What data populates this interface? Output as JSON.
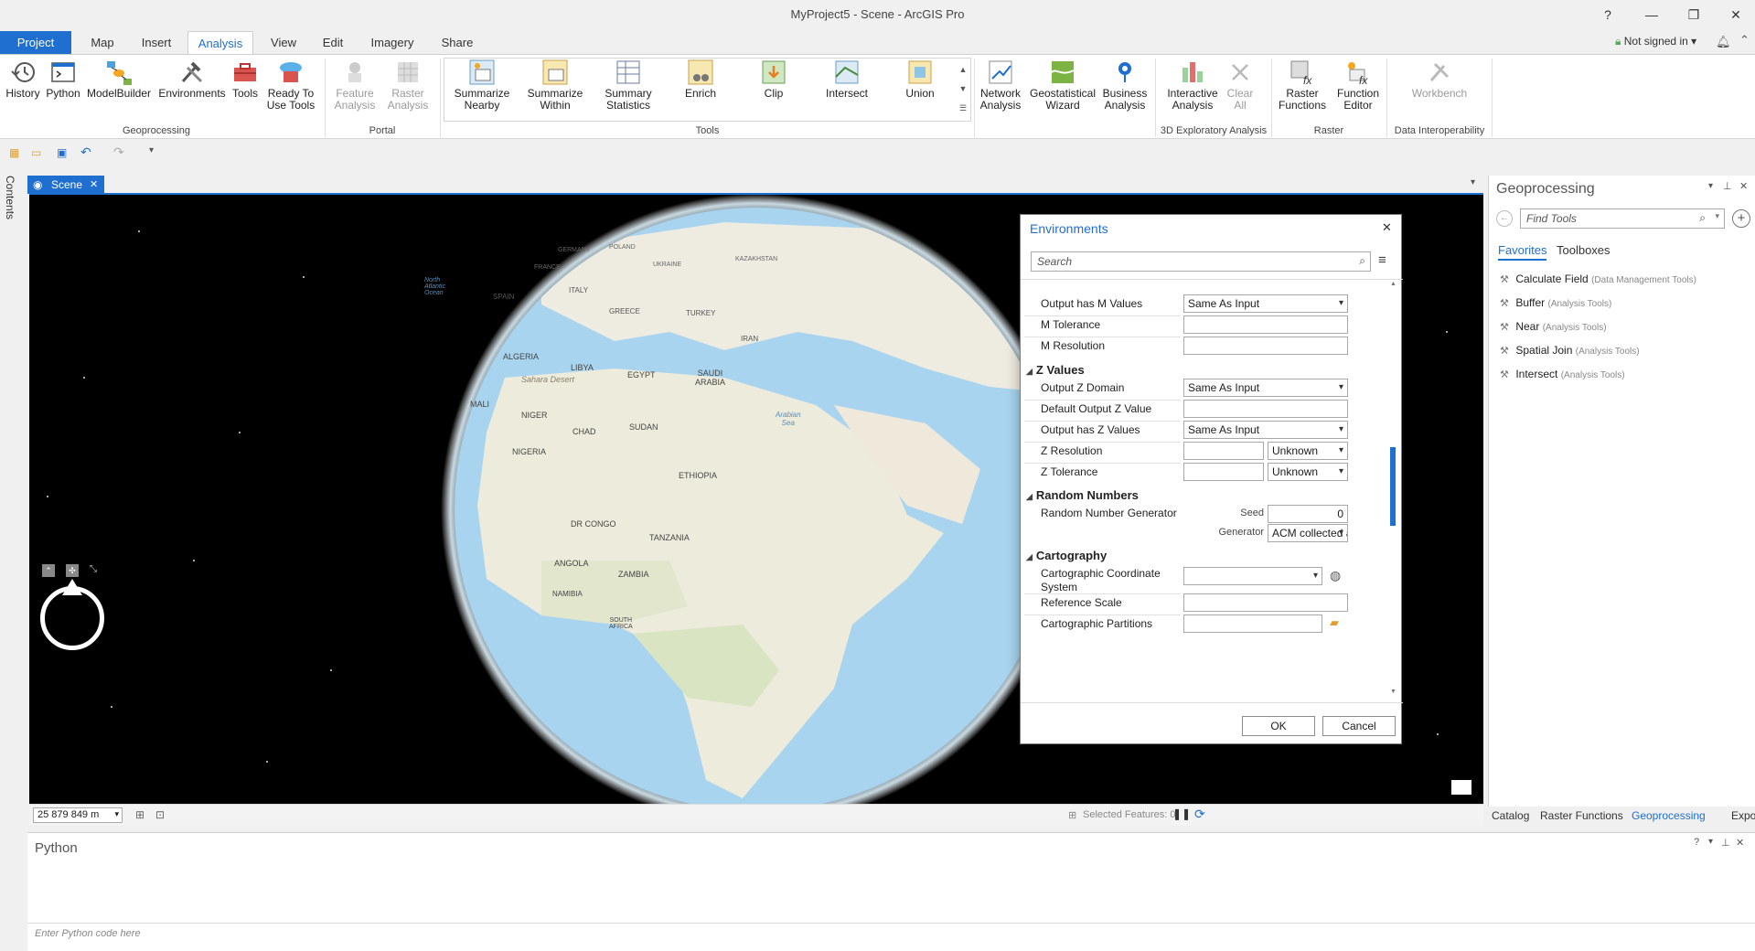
{
  "window": {
    "title": "MyProject5 - Scene - ArcGIS Pro",
    "help": "?",
    "minimize": "—",
    "restore": "❐",
    "close": "✕"
  },
  "ribbon_tabs": [
    "Project",
    "Map",
    "Insert",
    "Analysis",
    "View",
    "Edit",
    "Imagery",
    "Share"
  ],
  "account": {
    "label": "Not signed in",
    "caret": "▾"
  },
  "ribbon": {
    "geoprocessing": {
      "label": "Geoprocessing",
      "buttons": [
        {
          "label": "History"
        },
        {
          "label": "Python"
        },
        {
          "label": "ModelBuilder"
        },
        {
          "label": "Environments"
        },
        {
          "label": "Tools"
        },
        {
          "label": "Ready To\nUse Tools"
        }
      ]
    },
    "portal": {
      "label": "Portal",
      "buttons": [
        {
          "label": "Feature\nAnalysis"
        },
        {
          "label": "Raster\nAnalysis"
        }
      ]
    },
    "tools": {
      "label": "Tools",
      "buttons": [
        {
          "label": "Summarize\nNearby"
        },
        {
          "label": "Summarize\nWithin"
        },
        {
          "label": "Summary\nStatistics"
        },
        {
          "label": "Enrich"
        },
        {
          "label": "Clip"
        },
        {
          "label": "Intersect"
        },
        {
          "label": "Union"
        }
      ]
    },
    "other": {
      "buttons": [
        {
          "label": "Network\nAnalysis"
        },
        {
          "label": "Geostatistical\nWizard"
        },
        {
          "label": "Business\nAnalysis"
        }
      ]
    },
    "exploratory": {
      "label": "3D Exploratory Analysis",
      "buttons": [
        {
          "label": "Interactive\nAnalysis"
        },
        {
          "label": "Clear\nAll"
        }
      ]
    },
    "raster": {
      "label": "Raster",
      "buttons": [
        {
          "label": "Raster\nFunctions"
        },
        {
          "label": "Function\nEditor"
        }
      ]
    },
    "interop": {
      "label": "Data Interoperability",
      "buttons": [
        {
          "label": "Workbench"
        }
      ]
    }
  },
  "side_strip": {
    "contents": "Contents"
  },
  "scene_tab": {
    "label": "Scene",
    "close": "✕"
  },
  "map": {
    "labels": [
      "GERMANY",
      "POLAND",
      "UKRAINE",
      "KAZAKHSTAN",
      "FRANCE",
      "SPAIN",
      "ITALY",
      "GREECE",
      "TURKEY",
      "IRAN",
      "ALGERIA",
      "LIBYA",
      "EGYPT",
      "SAUDI\nARABIA",
      "Sahara Desert",
      "MALI",
      "NIGER",
      "CHAD",
      "SUDAN",
      "NIGERIA",
      "ETHIOPIA",
      "DR CONGO",
      "TANZANIA",
      "ANGOLA",
      "ZAMBIA",
      "NAMIBIA",
      "SOUTH\nAFRICA",
      "Arabian\nSea",
      "North\nAtlantic\nOcean"
    ]
  },
  "status": {
    "scale": "25 879 849 m",
    "selected_features": "Selected Features: 0"
  },
  "environments": {
    "title": "Environments",
    "close": "✕",
    "search_placeholder": "Search",
    "rows": [
      {
        "label": "Output has M Values",
        "value": "Same As Input"
      },
      {
        "label": "M Tolerance",
        "value": ""
      },
      {
        "label": "M Resolution",
        "value": ""
      }
    ],
    "z_values": {
      "section": "Z Values",
      "rows": [
        {
          "label": "Output Z Domain",
          "value": "Same As Input"
        },
        {
          "label": "Default Output Z Value",
          "value": ""
        },
        {
          "label": "Output has Z Values",
          "value": "Same As Input"
        },
        {
          "label": "Z Resolution",
          "value": "",
          "unit": "Unknown"
        },
        {
          "label": "Z Tolerance",
          "value": "",
          "unit": "Unknown"
        }
      ]
    },
    "random": {
      "section": "Random Numbers",
      "label": "Random Number Generator",
      "seed_label": "Seed",
      "seed_value": "0",
      "generator_label": "Generator",
      "generator_value": "ACM collected alg"
    },
    "cartography": {
      "section": "Cartography",
      "rows": [
        {
          "label": "Cartographic Coordinate\nSystem",
          "value": ""
        },
        {
          "label": "Reference Scale",
          "value": ""
        },
        {
          "label": "Cartographic Partitions",
          "value": ""
        }
      ]
    },
    "ok": "OK",
    "cancel": "Cancel"
  },
  "geoprocessing_pane": {
    "title": "Geoprocessing",
    "search_placeholder": "Find Tools",
    "tabs": [
      "Favorites",
      "Toolboxes"
    ],
    "favorites": [
      {
        "name": "Calculate Field",
        "toolbox": "(Data Management Tools)"
      },
      {
        "name": "Buffer",
        "toolbox": "(Analysis Tools)"
      },
      {
        "name": "Near",
        "toolbox": "(Analysis Tools)"
      },
      {
        "name": "Spatial Join",
        "toolbox": "(Analysis Tools)"
      },
      {
        "name": "Intersect",
        "toolbox": "(Analysis Tools)"
      }
    ]
  },
  "bottom_tabs": [
    "Catalog",
    "Raster Functions",
    "Geoprocessing",
    "Export"
  ],
  "python_pane": {
    "title": "Python",
    "placeholder": "Enter Python code here"
  },
  "colors": {
    "accent": "#1f6fd1",
    "ocean": "#a8d4ef",
    "land": "#f0ede4"
  }
}
